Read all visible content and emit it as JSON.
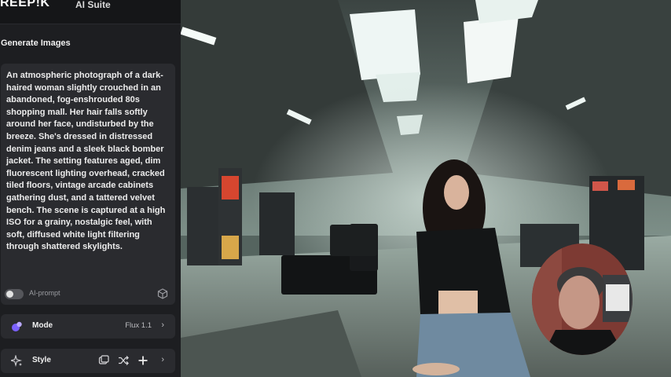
{
  "header": {
    "brand": "REEP!K",
    "suite": "AI Suite"
  },
  "section": {
    "title": "Generate Images"
  },
  "prompt": {
    "text": "An atmospheric photograph of a dark-haired woman slightly crouched in an abandoned, fog-enshrouded 80s shopping mall. Her hair falls softly around her face, undisturbed by the breeze. She's dressed in distressed denim jeans and a sleek black bomber jacket. The setting features aged, dim fluorescent lighting overhead, cracked tiled floors, vintage arcade cabinets gathering dust, and a tattered velvet bench. The scene is captured at a high ISO for a grainy, nostalgic feel, with soft, diffused white light filtering through shattered skylights.",
    "ai_prompt_label": "AI-prompt",
    "ai_prompt_enabled": false
  },
  "mode": {
    "label": "Mode",
    "value": "Flux 1.1"
  },
  "style": {
    "label": "Style"
  },
  "colors": {
    "panel": "#1d1e21",
    "card": "#2a2b2f",
    "mode_icon": "#7b61ff",
    "accent_text": "#f0f0f0"
  },
  "icons": {
    "ai_prompt": "cube-icon",
    "mode": "mode-icon",
    "style": "sparkle-icon",
    "style_tools": [
      "image-reference-icon",
      "shuffle-icon",
      "plus-icon"
    ],
    "chevron": "chevron-right-icon"
  }
}
